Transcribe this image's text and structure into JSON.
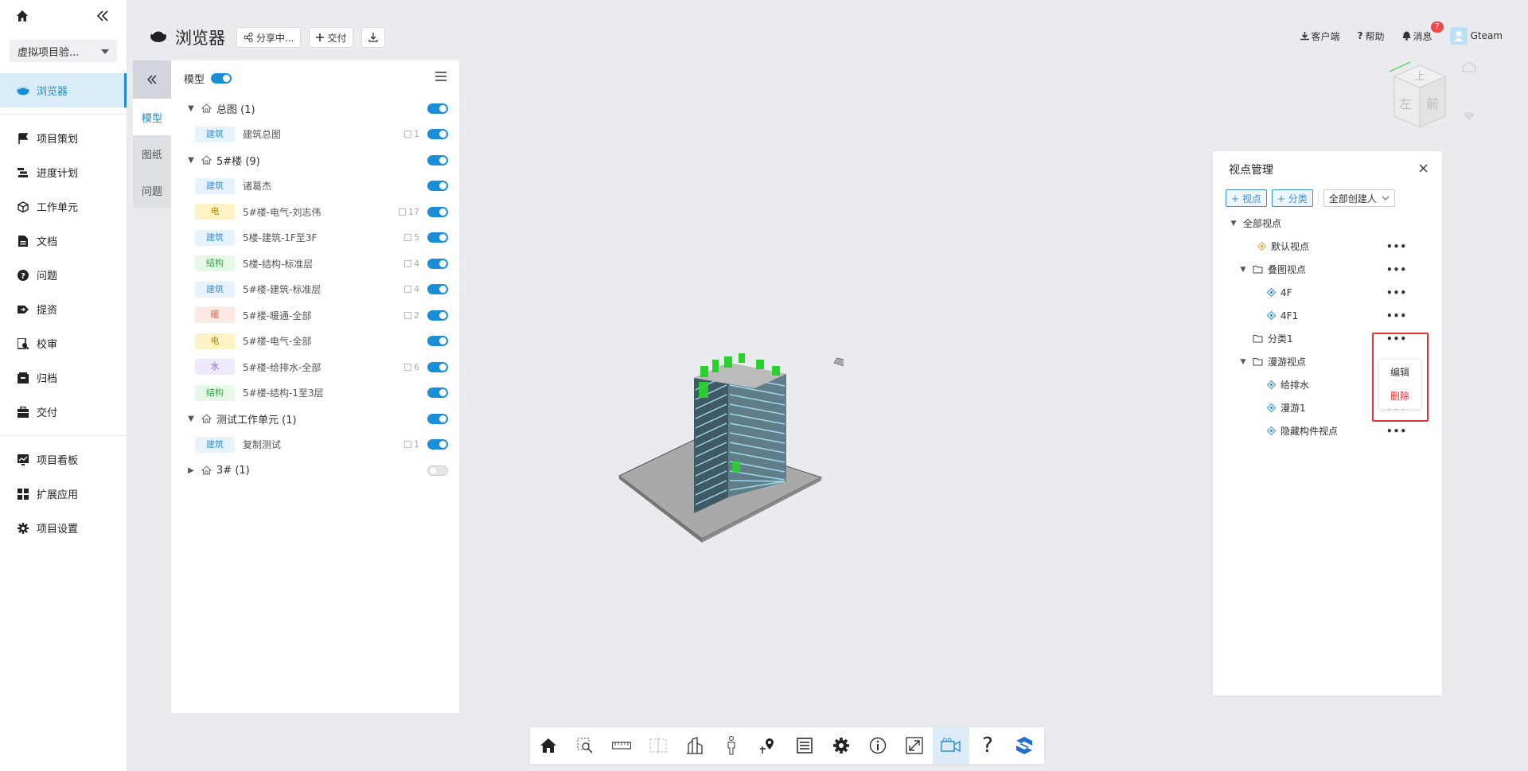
{
  "nav": {
    "project": "虚拟项目验...",
    "items": [
      {
        "label": "浏览器",
        "icon": "eye-icon",
        "active": true
      },
      {
        "label": "项目策划",
        "icon": "flag-icon"
      },
      {
        "label": "进度计划",
        "icon": "schedule-icon"
      },
      {
        "label": "工作单元",
        "icon": "cube-icon"
      },
      {
        "label": "文档",
        "icon": "document-icon"
      },
      {
        "label": "问题",
        "icon": "question-icon"
      },
      {
        "label": "提资",
        "icon": "submit-icon"
      },
      {
        "label": "校审",
        "icon": "review-icon"
      },
      {
        "label": "归档",
        "icon": "archive-icon"
      },
      {
        "label": "交付",
        "icon": "briefcase-icon"
      },
      {
        "label": "项目看板",
        "icon": "dashboard-icon"
      },
      {
        "label": "扩展应用",
        "icon": "apps-icon"
      },
      {
        "label": "项目设置",
        "icon": "gear-icon"
      }
    ]
  },
  "header": {
    "title": "浏览器",
    "share_label": "分享中...",
    "deliver_label": "交付",
    "client_label": "客户端",
    "help_label": "帮助",
    "message_label": "消息",
    "message_count": "7",
    "user": "Gteam"
  },
  "vtabs": [
    "模型",
    "图纸",
    "问题"
  ],
  "tree": {
    "header_label": "模型",
    "groups": [
      {
        "label": "总图",
        "count": "(1)",
        "on": true,
        "expanded": true,
        "items": [
          {
            "tag": "建筑",
            "tag_type": "jz",
            "label": "建筑总图",
            "num": "1",
            "on": true
          }
        ]
      },
      {
        "label": "5#楼",
        "count": "(9)",
        "on": true,
        "expanded": true,
        "items": [
          {
            "tag": "建筑",
            "tag_type": "jz",
            "label": "诸葛杰",
            "num": "",
            "on": true
          },
          {
            "tag": "电",
            "tag_type": "dian",
            "label": "5#楼-电气-刘志伟",
            "num": "17",
            "on": true
          },
          {
            "tag": "建筑",
            "tag_type": "jz",
            "label": "5楼-建筑-1F至3F",
            "num": "5",
            "on": true
          },
          {
            "tag": "结构",
            "tag_type": "jg",
            "label": "5楼-结构-标准层",
            "num": "4",
            "on": true
          },
          {
            "tag": "建筑",
            "tag_type": "jz",
            "label": "5#楼-建筑-标准层",
            "num": "4",
            "on": true
          },
          {
            "tag": "暖",
            "tag_type": "nuan",
            "label": "5#楼-暖通-全部",
            "num": "2",
            "on": true
          },
          {
            "tag": "电",
            "tag_type": "dian",
            "label": "5#楼-电气-全部",
            "num": "",
            "on": true
          },
          {
            "tag": "水",
            "tag_type": "shui",
            "label": "5#楼-给排水-全部",
            "num": "6",
            "on": true
          },
          {
            "tag": "结构",
            "tag_type": "jg",
            "label": "5#楼-结构-1至3层",
            "num": "",
            "on": true
          }
        ]
      },
      {
        "label": "测试工作单元",
        "count": "(1)",
        "on": true,
        "expanded": true,
        "items": [
          {
            "tag": "建筑",
            "tag_type": "jz",
            "label": "复制测试",
            "num": "1",
            "on": true
          }
        ]
      },
      {
        "label": "3#",
        "count": "(1)",
        "on": false,
        "expanded": false,
        "items": []
      }
    ]
  },
  "viewcube": {
    "top": "上",
    "left": "左",
    "front": "前"
  },
  "viewpoints": {
    "title": "视点管理",
    "add_view": "+ 视点",
    "add_category": "+ 分类",
    "creator_filter": "全部创建人",
    "nodes": [
      {
        "label": "全部视点",
        "level": 0,
        "type": "root"
      },
      {
        "label": "默认视点",
        "level": 1,
        "type": "default"
      },
      {
        "label": "叠图视点",
        "level": 1,
        "type": "folder"
      },
      {
        "label": "4F",
        "level": 2,
        "type": "view"
      },
      {
        "label": "4F1",
        "level": 2,
        "type": "view"
      },
      {
        "label": "分类1",
        "level": 1,
        "type": "folder-leaf"
      },
      {
        "label": "漫游视点",
        "level": 1,
        "type": "folder"
      },
      {
        "label": "给排水",
        "level": 2,
        "type": "view"
      },
      {
        "label": "漫游1",
        "level": 2,
        "type": "view"
      },
      {
        "label": "隐藏构件视点",
        "level": 2,
        "type": "view"
      }
    ],
    "context_menu": {
      "edit": "编辑",
      "delete": "删除"
    }
  },
  "colors": {
    "accent": "#1a8fd8",
    "danger": "#e23333"
  },
  "bottom_tools": [
    "home-icon",
    "zoom-box-icon",
    "measure-icon",
    "section-icon",
    "floor-icon",
    "person-icon",
    "pin-icon",
    "list-icon",
    "gear-icon",
    "info-icon",
    "fullscreen-icon",
    "video-icon",
    "help-icon",
    "logo-icon"
  ]
}
